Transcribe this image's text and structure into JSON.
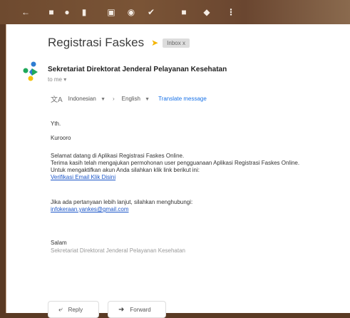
{
  "toolbar": {
    "icons": [
      "back-icon",
      "archive-icon",
      "report-spam-icon",
      "delete-icon",
      "mark-unread-icon",
      "snooze-icon",
      "add-task-icon",
      "move-to-icon",
      "label-icon",
      "more-icon"
    ]
  },
  "email": {
    "subject": "Registrasi Faskes",
    "label": "Inbox x",
    "sender": "Sekretariat Direktorat Jenderal Pelayanan Kesehatan",
    "to": "to me",
    "translate": {
      "from": "Indonesian",
      "to": "English",
      "link": "Translate message"
    },
    "body": {
      "greeting": "Yth.",
      "name": "Kurooro",
      "line1": "Selamat datang di Aplikasi Registrasi Faskes Online.",
      "line2": "Terima kasih telah mengajukan permohonan user pengguanaan Aplikasi Registrasi Faskes Online.",
      "line3": "Untuk mengaktifkan akun Anda silahkan klik link berikut ini:",
      "verify_link": "Verifikasi Email Klik Disini",
      "question": "Jika ada pertanyaan lebih lanjut, silahkan menghubungi:",
      "contact_email": "infokeraan.yankes@gmail.com",
      "closing": "Salam",
      "signature": "Sekretariat Direktorat Jenderal Pelayanan Kesehatan"
    }
  },
  "actions": {
    "reply": "Reply",
    "forward": "Forward"
  },
  "colors": {
    "toolbar": "#6e4a2f",
    "link": "#1a55c8",
    "star": "#f4b400"
  }
}
